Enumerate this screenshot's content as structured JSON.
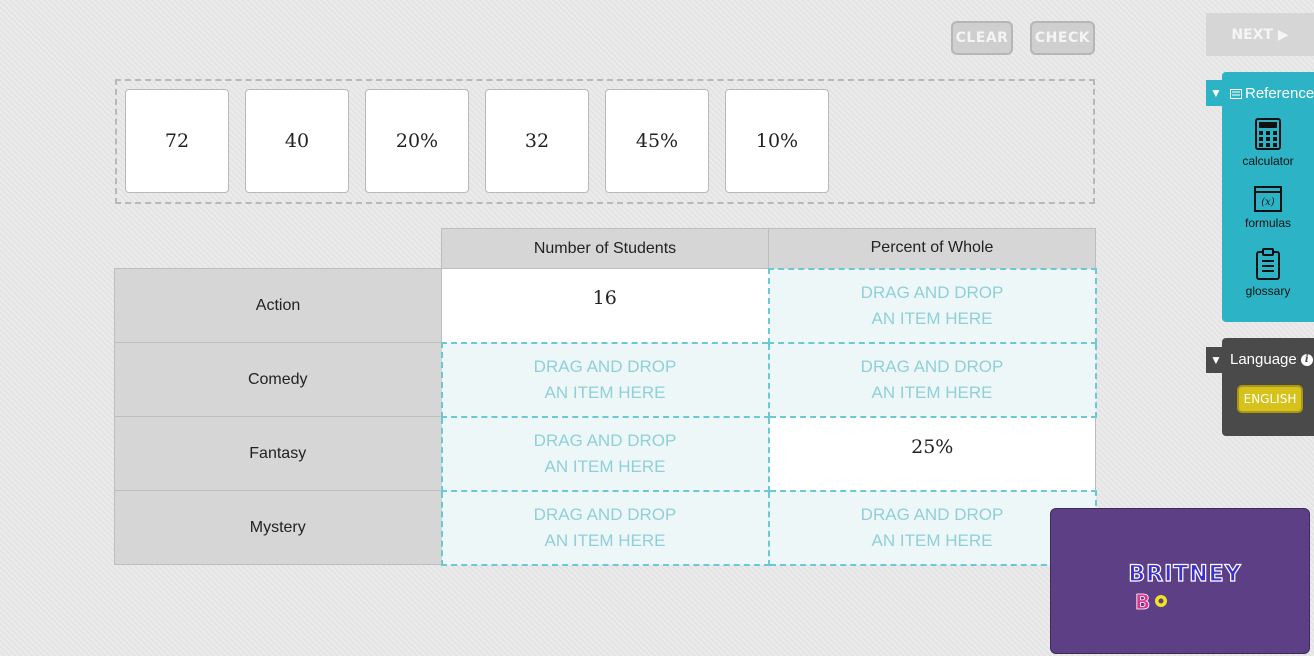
{
  "toolbar": {
    "clear_label": "CLEAR",
    "check_label": "CHECK",
    "next_label": "NEXT ▶"
  },
  "tray": {
    "tiles": [
      "72",
      "40",
      "20%",
      "32",
      "45%",
      "10%"
    ]
  },
  "table": {
    "headers": [
      "Number of Students",
      "Percent of Whole"
    ],
    "rows": [
      {
        "label": "Action",
        "students": "16",
        "percent": null
      },
      {
        "label": "Comedy",
        "students": null,
        "percent": null
      },
      {
        "label": "Fantasy",
        "students": null,
        "percent": "25%"
      },
      {
        "label": "Mystery",
        "students": null,
        "percent": null
      }
    ],
    "drop_line1": "DRAG AND DROP",
    "drop_line2": "AN ITEM HERE"
  },
  "reference": {
    "title": "Reference",
    "tools": [
      {
        "label": "calculator",
        "icon": "calculator-icon"
      },
      {
        "label": "formulas",
        "icon": "formulas-icon"
      },
      {
        "label": "glossary",
        "icon": "glossary-icon"
      }
    ]
  },
  "language": {
    "title": "Language",
    "selected": "ENGLISH"
  },
  "widget": {
    "logo_text": "BRITNEY B"
  },
  "colors": {
    "accent": "#2cb4c6",
    "drop_border": "#6cc9d3",
    "english_button": "#d6c21b",
    "widget_bg": "#5d3f86"
  }
}
